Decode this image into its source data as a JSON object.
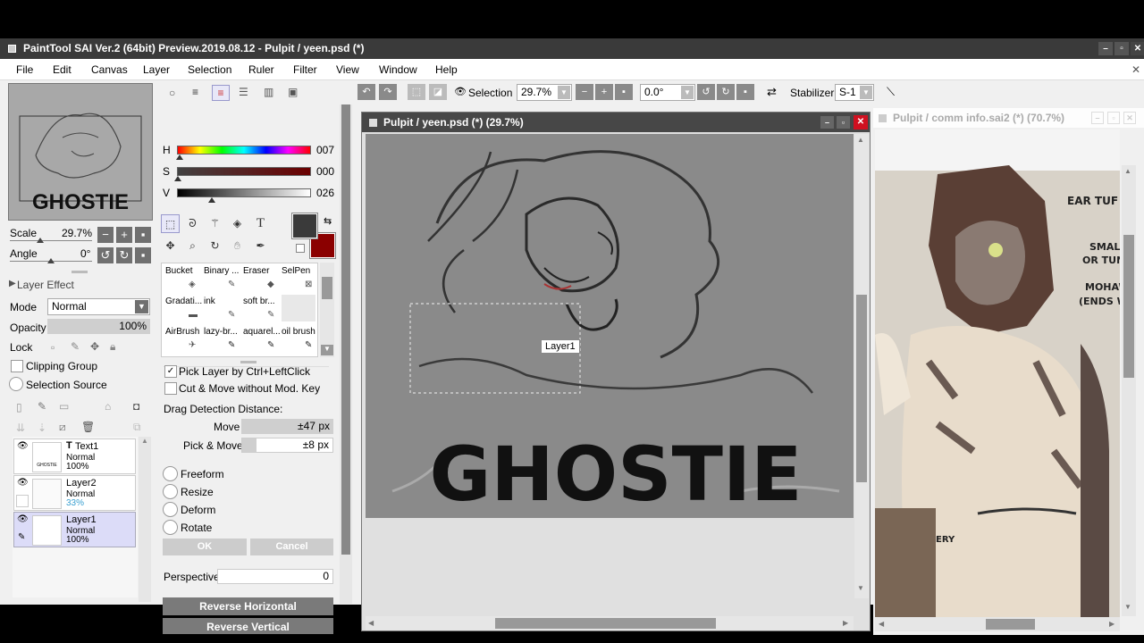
{
  "app": {
    "title": "PaintTool SAI Ver.2 (64bit) Preview.2019.08.12 - Pulpit / yeen.psd (*)",
    "window_buttons": [
      "–",
      "▫",
      "✕"
    ]
  },
  "menu": [
    "File",
    "Edit",
    "Canvas",
    "Layer",
    "Selection",
    "Ruler",
    "Filter",
    "View",
    "Window",
    "Help"
  ],
  "navigator": {
    "thumb_text": "GHOSTIE",
    "scale_label": "Scale",
    "scale_value": "29.7%",
    "angle_label": "Angle",
    "angle_value": "0°"
  },
  "layer_props": {
    "layer_effect": "Layer Effect",
    "mode_label": "Mode",
    "mode_value": "Normal",
    "opacity_label": "Opacity",
    "opacity_value": "100%",
    "lock_label": "Lock",
    "clipping_group": "Clipping Group",
    "selection_source": "Selection Source"
  },
  "layers": [
    {
      "name": "Text1",
      "mode": "Normal",
      "opacity": "100%",
      "thumb_text": "GHOSTIE"
    },
    {
      "name": "Layer2",
      "mode": "Normal",
      "opacity": "33%"
    },
    {
      "name": "Layer1",
      "mode": "Normal",
      "opacity": "100%"
    }
  ],
  "color": {
    "h_label": "H",
    "h_value": "007",
    "s_label": "S",
    "s_value": "000",
    "v_label": "V",
    "v_value": "026",
    "primary": "#3a3a3a",
    "secondary": "#8b0000"
  },
  "brushes": [
    [
      "Bucket",
      "Binary ...",
      "Eraser",
      "SelPen"
    ],
    [
      "Gradati...",
      "ink",
      "soft br...",
      ""
    ],
    [
      "AirBrush",
      "lazy-br...",
      "aquarel...",
      "oil brush"
    ]
  ],
  "move_tool": {
    "pick_layer": "Pick Layer by Ctrl+LeftClick",
    "cut_move": "Cut & Move without Mod. Key",
    "drag_detection": "Drag Detection Distance:",
    "move_label": "Move",
    "move_value": "±47 px",
    "pick_move_label": "Pick & Move",
    "pick_move_value": "±8 px",
    "options": [
      "Freeform",
      "Resize",
      "Deform",
      "Rotate"
    ],
    "ok": "OK",
    "cancel": "Cancel",
    "perspective_label": "Perspective",
    "perspective_value": "0",
    "reverse_h": "Reverse Horizontal",
    "reverse_v": "Reverse Vertical"
  },
  "toolbar": {
    "selection_label": "Selection",
    "zoom_value": "29.7%",
    "angle_value": "0.0°",
    "stabilizer_label": "Stabilizer",
    "stabilizer_value": "S-1"
  },
  "canvas_window": {
    "title": "Pulpit / yeen.psd (*) (29.7%)",
    "art_text": "GHOSTIE",
    "tooltip": "Layer1"
  },
  "ref_window": {
    "title": "Pulpit / comm info.sai2 (*) (70.7%)",
    "notes": [
      "EAR TUF",
      "SMALL",
      "OR TUNE",
      "MOHAW",
      "(ENDS W",
      "ERY"
    ]
  }
}
